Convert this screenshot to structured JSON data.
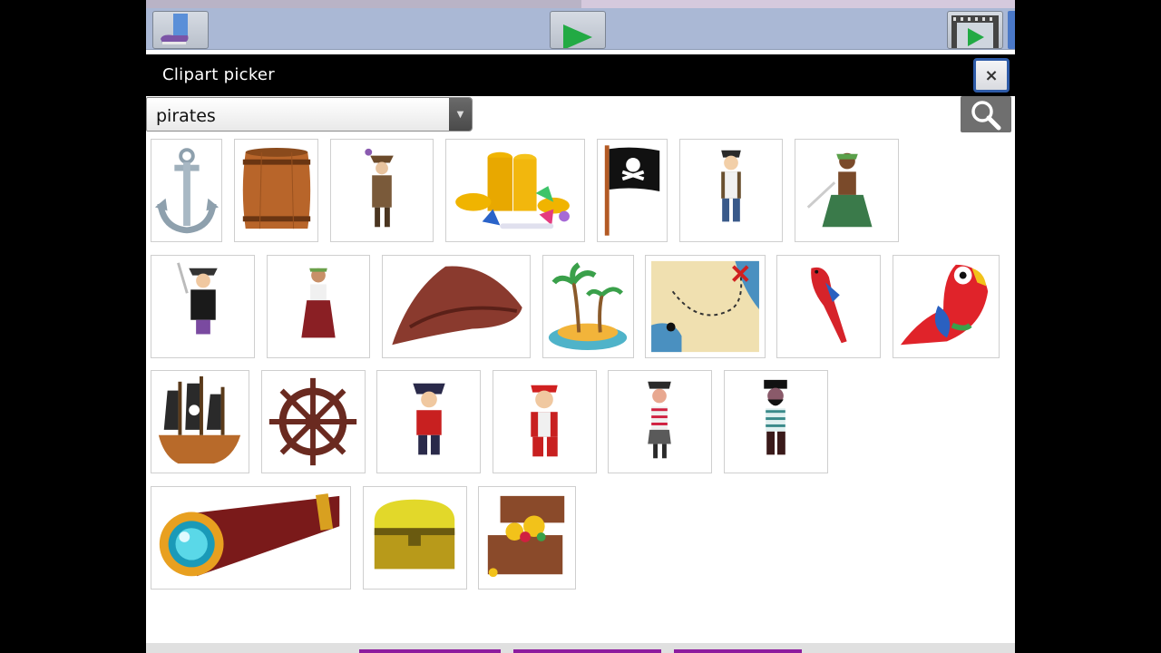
{
  "dialog": {
    "title": "Clipart picker",
    "close_label": "×"
  },
  "search": {
    "selected_category": "pirates",
    "icon": "magnifier-icon"
  },
  "toolbar": {
    "buttons": [
      "character-icon",
      "play-icon",
      "film-play-icon"
    ]
  },
  "clipart_items": [
    "anchor",
    "barrel",
    "pirate-with-hat",
    "gold-coins-and-gems",
    "jolly-roger-flag",
    "pirate-boy",
    "pirate-girl-with-sword",
    "pirate-woman-with-sword",
    "pirate-girl-in-dress",
    "tricorn-hat",
    "palm-tree-island",
    "treasure-map",
    "red-parrot-flying",
    "red-parrot-perched",
    "pirate-ship",
    "ship-wheel",
    "pirate-captain",
    "red-bandana-pirate",
    "striped-pirate-girl",
    "bearded-pirate",
    "spyglass",
    "closed-treasure-chest",
    "open-treasure-chest"
  ],
  "colors": {
    "title_bar": "#000000",
    "toolbar": "#aab8d5",
    "close_border": "#2e5ba8",
    "search_button": "#6f6f6f",
    "bottom_tabs": "#8d1c9e"
  }
}
